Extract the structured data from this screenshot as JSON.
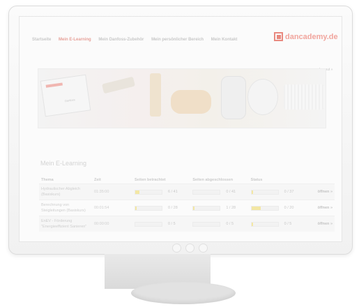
{
  "nav": {
    "items": [
      {
        "label": "Startseite",
        "active": false
      },
      {
        "label": "Mein E-Learning",
        "active": true
      },
      {
        "label": "Mein Danfoss-Zubehör",
        "active": false
      },
      {
        "label": "Mein persönlicher Bereich",
        "active": false
      },
      {
        "label": "Mein Kontakt",
        "active": false
      }
    ],
    "logout": "Logout »"
  },
  "brand": {
    "name": "dancademy.de",
    "accent": "#e98a80"
  },
  "banner": {
    "brochure_brand": "Danfoss",
    "brochure_title": "Danfoss"
  },
  "page_title": "Mein E-Learning",
  "table": {
    "headers": [
      "Thema",
      "Zeit",
      "Seiten betrachtet",
      "Seiten abgeschlossen",
      "Status",
      ""
    ],
    "rows": [
      {
        "topic": "Hydraulischer Abgleich (Basiskurs)",
        "time": "01:35:00",
        "viewed": {
          "count": "6 / 41",
          "fraction": 0.15
        },
        "completed": {
          "count": "0 / 41",
          "fraction": 0.0
        },
        "status": {
          "count": "0 / 37",
          "fraction": 0.05
        },
        "action": "öffnen »"
      },
      {
        "topic": "Berechnung von Steigleitungen (Basiskurs)",
        "time": "00:01:54",
        "viewed": {
          "count": "0 / 28",
          "fraction": 0.05
        },
        "completed": {
          "count": "1 / 28",
          "fraction": 0.04
        },
        "status": {
          "count": "0 / 20",
          "fraction": 0.35
        },
        "action": "öffnen »"
      },
      {
        "topic": "EnEV - Förderung \"Energieeffizient Sanieren\"",
        "time": "00:00:00",
        "viewed": {
          "count": "0 / 5",
          "fraction": 0.0
        },
        "completed": {
          "count": "0 / 5",
          "fraction": 0.0
        },
        "status": {
          "count": "0 / 5",
          "fraction": 0.05
        },
        "action": "öffnen »"
      }
    ]
  }
}
